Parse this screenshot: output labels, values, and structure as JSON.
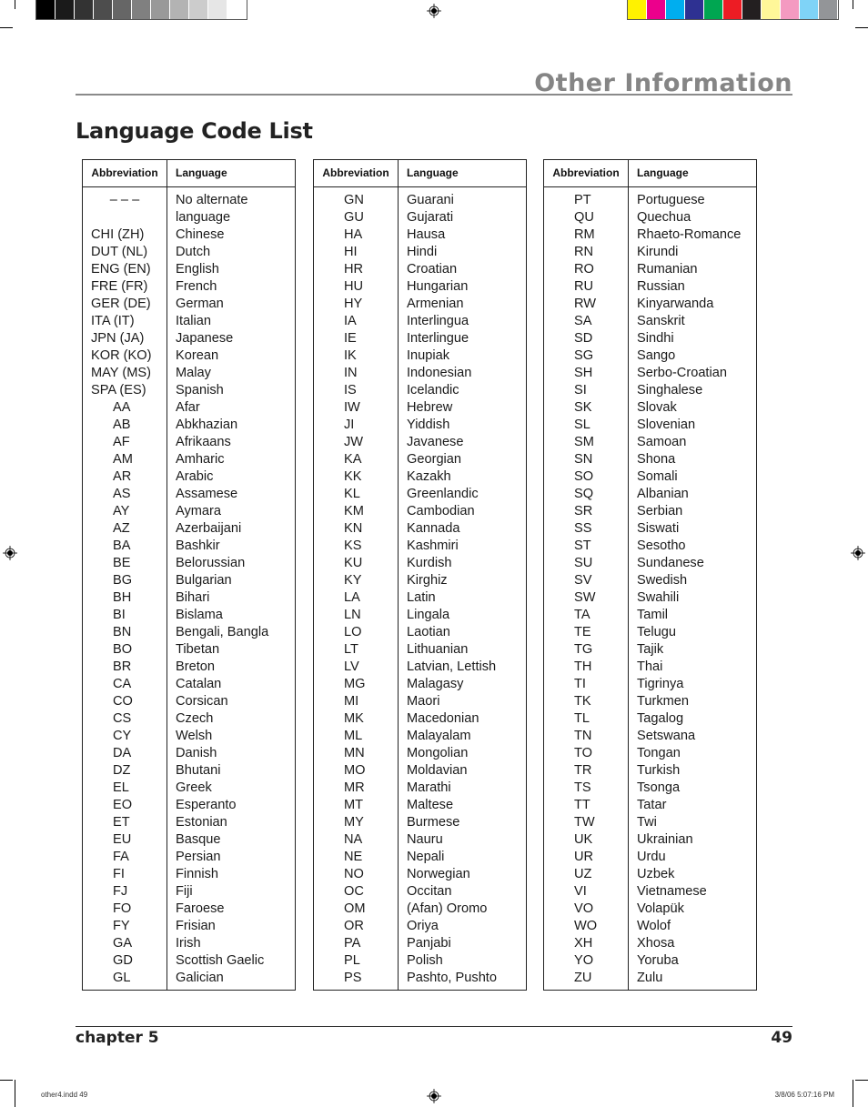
{
  "print_marks": {
    "gray_swatches": [
      "#000000",
      "#1a1a1a",
      "#333333",
      "#4d4d4d",
      "#666666",
      "#808080",
      "#999999",
      "#b3b3b3",
      "#cccccc",
      "#e6e6e6",
      "#ffffff"
    ],
    "color_swatches": [
      "#fff200",
      "#ec008c",
      "#00aeef",
      "#2e3192",
      "#00a651",
      "#ed1c24",
      "#231f20",
      "#fff799",
      "#f49ac1",
      "#7fd3f7",
      "#939598"
    ]
  },
  "header": {
    "section_title": "Other Information",
    "page_title": "Language Code List",
    "section_title_color": "#858585"
  },
  "tables": [
    {
      "header": {
        "abbreviation": "Abbreviation",
        "language": "Language"
      },
      "rows": [
        {
          "abbr": "– – –",
          "lang": "No alternate",
          "style": "center"
        },
        {
          "abbr": "",
          "lang": "language",
          "style": "center"
        },
        {
          "abbr": "CHI (ZH)",
          "lang": "Chinese",
          "style": "left"
        },
        {
          "abbr": "DUT (NL)",
          "lang": "Dutch",
          "style": "left"
        },
        {
          "abbr": "ENG (EN)",
          "lang": "English",
          "style": "left"
        },
        {
          "abbr": "FRE (FR)",
          "lang": "French",
          "style": "left"
        },
        {
          "abbr": "GER (DE)",
          "lang": "German",
          "style": "left"
        },
        {
          "abbr": "ITA (IT)",
          "lang": "Italian",
          "style": "left"
        },
        {
          "abbr": "JPN (JA)",
          "lang": "Japanese",
          "style": "left"
        },
        {
          "abbr": "KOR (KO)",
          "lang": "Korean",
          "style": "left"
        },
        {
          "abbr": "MAY (MS)",
          "lang": "Malay",
          "style": "left"
        },
        {
          "abbr": "SPA (ES)",
          "lang": "Spanish",
          "style": "left"
        },
        {
          "abbr": "AA",
          "lang": "Afar",
          "style": "code"
        },
        {
          "abbr": "AB",
          "lang": "Abkhazian",
          "style": "code"
        },
        {
          "abbr": "AF",
          "lang": "Afrikaans",
          "style": "code"
        },
        {
          "abbr": "AM",
          "lang": "Amharic",
          "style": "code"
        },
        {
          "abbr": "AR",
          "lang": "Arabic",
          "style": "code"
        },
        {
          "abbr": "AS",
          "lang": "Assamese",
          "style": "code"
        },
        {
          "abbr": "AY",
          "lang": "Aymara",
          "style": "code"
        },
        {
          "abbr": "AZ",
          "lang": "Azerbaijani",
          "style": "code"
        },
        {
          "abbr": "BA",
          "lang": "Bashkir",
          "style": "code"
        },
        {
          "abbr": "BE",
          "lang": "Belorussian",
          "style": "code"
        },
        {
          "abbr": "BG",
          "lang": "Bulgarian",
          "style": "code"
        },
        {
          "abbr": "BH",
          "lang": "Bihari",
          "style": "code"
        },
        {
          "abbr": "BI",
          "lang": "Bislama",
          "style": "code"
        },
        {
          "abbr": "BN",
          "lang": "Bengali, Bangla",
          "style": "code"
        },
        {
          "abbr": "BO",
          "lang": "Tibetan",
          "style": "code"
        },
        {
          "abbr": "BR",
          "lang": "Breton",
          "style": "code"
        },
        {
          "abbr": "CA",
          "lang": "Catalan",
          "style": "code"
        },
        {
          "abbr": "CO",
          "lang": "Corsican",
          "style": "code"
        },
        {
          "abbr": "CS",
          "lang": "Czech",
          "style": "code"
        },
        {
          "abbr": "CY",
          "lang": "Welsh",
          "style": "code"
        },
        {
          "abbr": "DA",
          "lang": "Danish",
          "style": "code"
        },
        {
          "abbr": "DZ",
          "lang": "Bhutani",
          "style": "code"
        },
        {
          "abbr": "EL",
          "lang": "Greek",
          "style": "code"
        },
        {
          "abbr": "EO",
          "lang": "Esperanto",
          "style": "code"
        },
        {
          "abbr": "ET",
          "lang": "Estonian",
          "style": "code"
        },
        {
          "abbr": "EU",
          "lang": "Basque",
          "style": "code"
        },
        {
          "abbr": "FA",
          "lang": "Persian",
          "style": "code"
        },
        {
          "abbr": "FI",
          "lang": "Finnish",
          "style": "code"
        },
        {
          "abbr": "FJ",
          "lang": "Fiji",
          "style": "code"
        },
        {
          "abbr": "FO",
          "lang": "Faroese",
          "style": "code"
        },
        {
          "abbr": "FY",
          "lang": "Frisian",
          "style": "code"
        },
        {
          "abbr": "GA",
          "lang": "Irish",
          "style": "code"
        },
        {
          "abbr": "GD",
          "lang": "Scottish Gaelic",
          "style": "code"
        },
        {
          "abbr": "GL",
          "lang": "Galician",
          "style": "code"
        }
      ]
    },
    {
      "header": {
        "abbreviation": "Abbreviation",
        "language": "Language"
      },
      "rows": [
        {
          "abbr": "GN",
          "lang": "Guarani",
          "style": "code"
        },
        {
          "abbr": "GU",
          "lang": "Gujarati",
          "style": "code"
        },
        {
          "abbr": "HA",
          "lang": "Hausa",
          "style": "code"
        },
        {
          "abbr": "HI",
          "lang": "Hindi",
          "style": "code"
        },
        {
          "abbr": "HR",
          "lang": "Croatian",
          "style": "code"
        },
        {
          "abbr": "HU",
          "lang": "Hungarian",
          "style": "code"
        },
        {
          "abbr": "HY",
          "lang": "Armenian",
          "style": "code"
        },
        {
          "abbr": "IA",
          "lang": "Interlingua",
          "style": "code"
        },
        {
          "abbr": "IE",
          "lang": "Interlingue",
          "style": "code"
        },
        {
          "abbr": "IK",
          "lang": "Inupiak",
          "style": "code"
        },
        {
          "abbr": "IN",
          "lang": "Indonesian",
          "style": "code"
        },
        {
          "abbr": "IS",
          "lang": "Icelandic",
          "style": "code"
        },
        {
          "abbr": "IW",
          "lang": "Hebrew",
          "style": "code"
        },
        {
          "abbr": "JI",
          "lang": "Yiddish",
          "style": "code"
        },
        {
          "abbr": "JW",
          "lang": "Javanese",
          "style": "code"
        },
        {
          "abbr": "KA",
          "lang": "Georgian",
          "style": "code"
        },
        {
          "abbr": "KK",
          "lang": "Kazakh",
          "style": "code"
        },
        {
          "abbr": "KL",
          "lang": "Greenlandic",
          "style": "code"
        },
        {
          "abbr": "KM",
          "lang": "Cambodian",
          "style": "code"
        },
        {
          "abbr": "KN",
          "lang": "Kannada",
          "style": "code"
        },
        {
          "abbr": "KS",
          "lang": "Kashmiri",
          "style": "code"
        },
        {
          "abbr": "KU",
          "lang": "Kurdish",
          "style": "code"
        },
        {
          "abbr": "KY",
          "lang": "Kirghiz",
          "style": "code"
        },
        {
          "abbr": "LA",
          "lang": "Latin",
          "style": "code"
        },
        {
          "abbr": "LN",
          "lang": "Lingala",
          "style": "code"
        },
        {
          "abbr": "LO",
          "lang": "Laotian",
          "style": "code"
        },
        {
          "abbr": "LT",
          "lang": "Lithuanian",
          "style": "code"
        },
        {
          "abbr": "LV",
          "lang": "Latvian, Lettish",
          "style": "code"
        },
        {
          "abbr": "MG",
          "lang": "Malagasy",
          "style": "code"
        },
        {
          "abbr": "MI",
          "lang": "Maori",
          "style": "code"
        },
        {
          "abbr": "MK",
          "lang": "Macedonian",
          "style": "code"
        },
        {
          "abbr": "ML",
          "lang": "Malayalam",
          "style": "code"
        },
        {
          "abbr": "MN",
          "lang": "Mongolian",
          "style": "code"
        },
        {
          "abbr": "MO",
          "lang": "Moldavian",
          "style": "code"
        },
        {
          "abbr": "MR",
          "lang": "Marathi",
          "style": "code"
        },
        {
          "abbr": "MT",
          "lang": "Maltese",
          "style": "code"
        },
        {
          "abbr": "MY",
          "lang": "Burmese",
          "style": "code"
        },
        {
          "abbr": "NA",
          "lang": "Nauru",
          "style": "code"
        },
        {
          "abbr": "NE",
          "lang": "Nepali",
          "style": "code"
        },
        {
          "abbr": "NO",
          "lang": "Norwegian",
          "style": "code"
        },
        {
          "abbr": "OC",
          "lang": "Occitan",
          "style": "code"
        },
        {
          "abbr": "OM",
          "lang": "(Afan) Oromo",
          "style": "code"
        },
        {
          "abbr": "OR",
          "lang": "Oriya",
          "style": "code"
        },
        {
          "abbr": "PA",
          "lang": "Panjabi",
          "style": "code"
        },
        {
          "abbr": "PL",
          "lang": "Polish",
          "style": "code"
        },
        {
          "abbr": "PS",
          "lang": "Pashto, Pushto",
          "style": "code"
        }
      ]
    },
    {
      "header": {
        "abbreviation": "Abbreviation",
        "language": "Language"
      },
      "rows": [
        {
          "abbr": "PT",
          "lang": "Portuguese",
          "style": "code"
        },
        {
          "abbr": "QU",
          "lang": "Quechua",
          "style": "code"
        },
        {
          "abbr": "RM",
          "lang": "Rhaeto-Romance",
          "style": "code"
        },
        {
          "abbr": "RN",
          "lang": "Kirundi",
          "style": "code"
        },
        {
          "abbr": "RO",
          "lang": "Rumanian",
          "style": "code"
        },
        {
          "abbr": "RU",
          "lang": "Russian",
          "style": "code"
        },
        {
          "abbr": "RW",
          "lang": "Kinyarwanda",
          "style": "code"
        },
        {
          "abbr": "SA",
          "lang": "Sanskrit",
          "style": "code"
        },
        {
          "abbr": "SD",
          "lang": "Sindhi",
          "style": "code"
        },
        {
          "abbr": "SG",
          "lang": "Sango",
          "style": "code"
        },
        {
          "abbr": "SH",
          "lang": "Serbo-Croatian",
          "style": "code"
        },
        {
          "abbr": "SI",
          "lang": "Singhalese",
          "style": "code"
        },
        {
          "abbr": "SK",
          "lang": "Slovak",
          "style": "code"
        },
        {
          "abbr": "SL",
          "lang": "Slovenian",
          "style": "code"
        },
        {
          "abbr": "SM",
          "lang": "Samoan",
          "style": "code"
        },
        {
          "abbr": "SN",
          "lang": "Shona",
          "style": "code"
        },
        {
          "abbr": "SO",
          "lang": "Somali",
          "style": "code"
        },
        {
          "abbr": "SQ",
          "lang": "Albanian",
          "style": "code"
        },
        {
          "abbr": "SR",
          "lang": "Serbian",
          "style": "code"
        },
        {
          "abbr": "SS",
          "lang": "Siswati",
          "style": "code"
        },
        {
          "abbr": "ST",
          "lang": "Sesotho",
          "style": "code"
        },
        {
          "abbr": "SU",
          "lang": "Sundanese",
          "style": "code"
        },
        {
          "abbr": "SV",
          "lang": "Swedish",
          "style": "code"
        },
        {
          "abbr": "SW",
          "lang": "Swahili",
          "style": "code"
        },
        {
          "abbr": "TA",
          "lang": "Tamil",
          "style": "code"
        },
        {
          "abbr": "TE",
          "lang": "Telugu",
          "style": "code"
        },
        {
          "abbr": "TG",
          "lang": "Tajik",
          "style": "code"
        },
        {
          "abbr": "TH",
          "lang": "Thai",
          "style": "code"
        },
        {
          "abbr": "TI",
          "lang": "Tigrinya",
          "style": "code"
        },
        {
          "abbr": "TK",
          "lang": "Turkmen",
          "style": "code"
        },
        {
          "abbr": "TL",
          "lang": "Tagalog",
          "style": "code"
        },
        {
          "abbr": "TN",
          "lang": "Setswana",
          "style": "code"
        },
        {
          "abbr": "TO",
          "lang": "Tongan",
          "style": "code"
        },
        {
          "abbr": "TR",
          "lang": "Turkish",
          "style": "code"
        },
        {
          "abbr": "TS",
          "lang": "Tsonga",
          "style": "code"
        },
        {
          "abbr": "TT",
          "lang": "Tatar",
          "style": "code"
        },
        {
          "abbr": "TW",
          "lang": "Twi",
          "style": "code"
        },
        {
          "abbr": "UK",
          "lang": "Ukrainian",
          "style": "code"
        },
        {
          "abbr": "UR",
          "lang": "Urdu",
          "style": "code"
        },
        {
          "abbr": "UZ",
          "lang": "Uzbek",
          "style": "code"
        },
        {
          "abbr": "VI",
          "lang": "Vietnamese",
          "style": "code"
        },
        {
          "abbr": "VO",
          "lang": "Volapük",
          "style": "code"
        },
        {
          "abbr": "WO",
          "lang": "Wolof",
          "style": "code"
        },
        {
          "abbr": "XH",
          "lang": "Xhosa",
          "style": "code"
        },
        {
          "abbr": "YO",
          "lang": "Yoruba",
          "style": "code"
        },
        {
          "abbr": "ZU",
          "lang": "Zulu",
          "style": "code"
        }
      ]
    }
  ],
  "footer": {
    "chapter": "chapter 5",
    "page_number": "49"
  },
  "slug": {
    "file": "other4.indd   49",
    "timestamp": "3/8/06   5:07:16 PM"
  }
}
